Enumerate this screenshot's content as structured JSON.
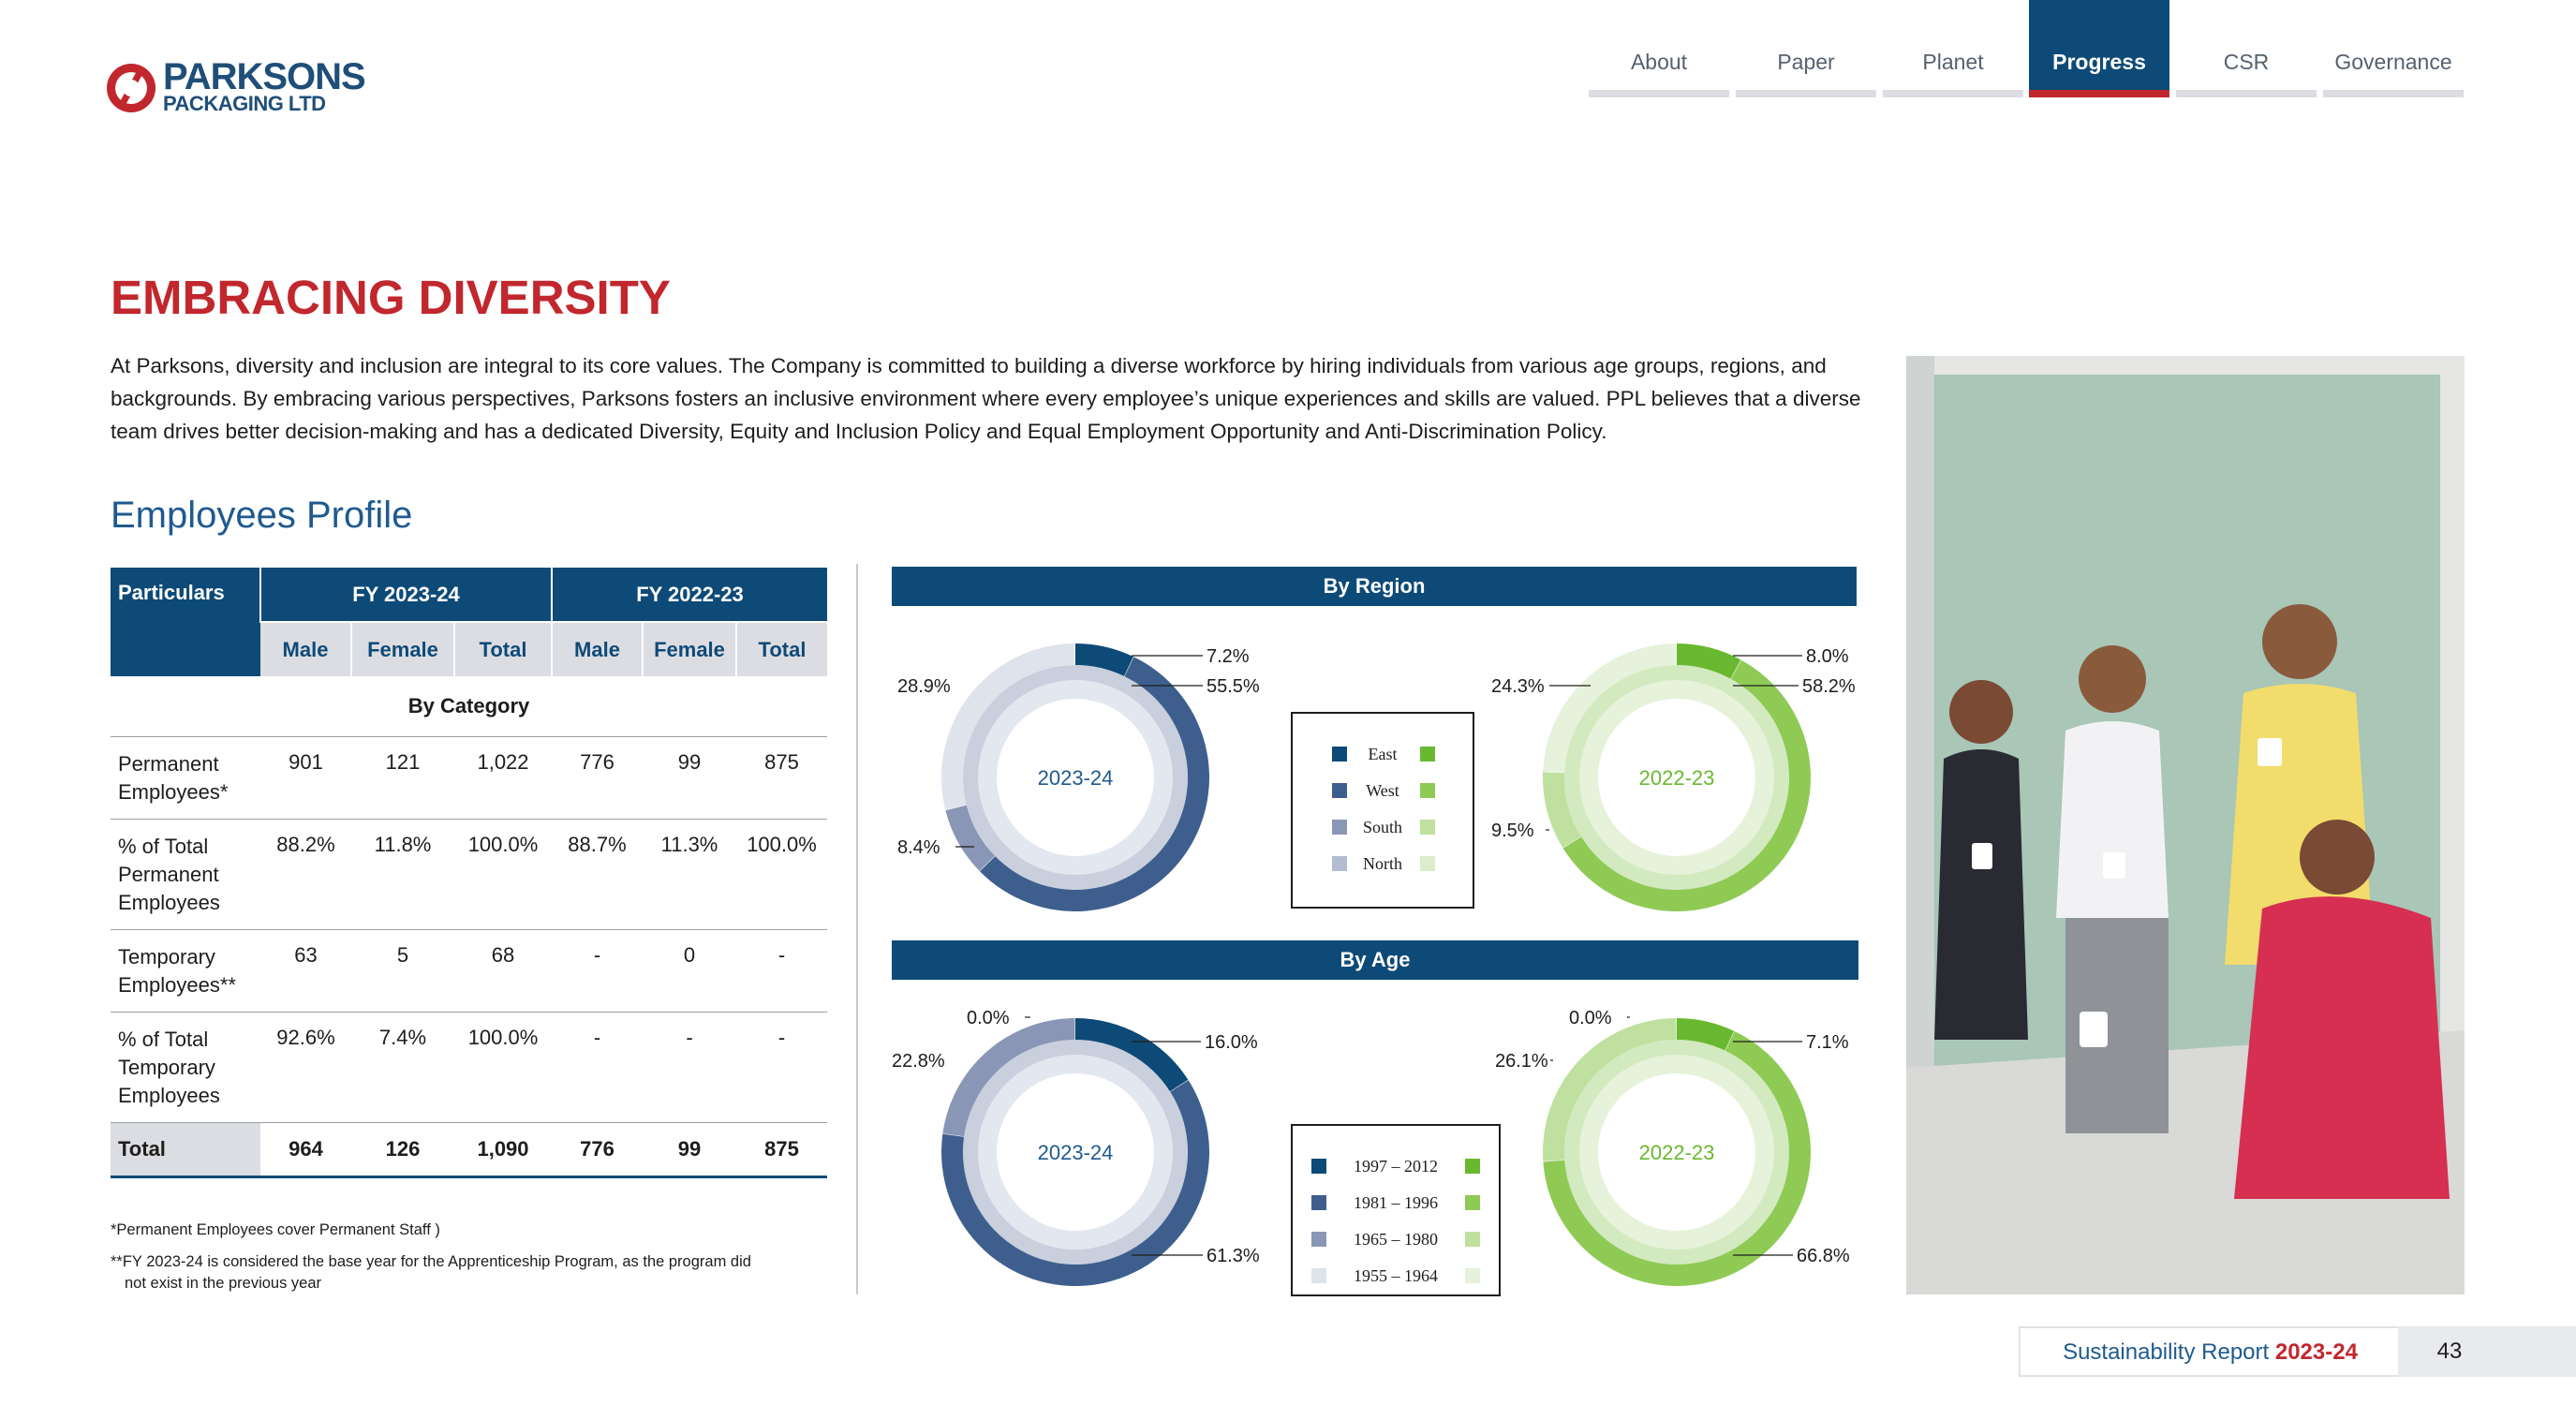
{
  "brand": {
    "line1": "PARKSONS",
    "line2": "PACKAGING LTD"
  },
  "nav": [
    {
      "label": "About",
      "active": false
    },
    {
      "label": "Paper",
      "active": false
    },
    {
      "label": "Planet",
      "active": false
    },
    {
      "label": "Progress",
      "active": true
    },
    {
      "label": "CSR",
      "active": false
    },
    {
      "label": "Governance",
      "active": false
    }
  ],
  "title": "EMBRACING DIVERSITY",
  "intro": "At Parksons, diversity and inclusion are integral to its core values. The Company is committed to building a diverse workforce by hiring individuals from various age groups, regions, and backgrounds. By embracing various perspectives, Parksons fosters an inclusive environment where every employee’s unique experiences and skills are valued. PPL believes that a diverse team drives better decision-making and has a dedicated Diversity, Equity and Inclusion Policy and Equal Employment Opportunity and Anti-Discrimination Policy.",
  "section_title": "Employees Profile",
  "table": {
    "particulars": "Particulars",
    "fy1": "FY 2023-24",
    "fy2": "FY 2022-23",
    "subheads": [
      "Male",
      "Female",
      "Total",
      "Male",
      "Female",
      "Total"
    ],
    "category": "By Category",
    "rows": [
      {
        "label": "Permanent Employees*",
        "values": [
          "901",
          "121",
          "1,022",
          "776",
          "99",
          "875"
        ]
      },
      {
        "label": "% of Total Permanent Employees",
        "values": [
          "88.2%",
          "11.8%",
          "100.0%",
          "88.7%",
          "11.3%",
          "100.0%"
        ]
      },
      {
        "label": "Temporary Employees**",
        "values": [
          "63",
          "5",
          "68",
          "-",
          "0",
          "-"
        ]
      },
      {
        "label": "% of Total Temporary Employees",
        "values": [
          "92.6%",
          "7.4%",
          "100.0%",
          "-",
          "-",
          "-"
        ]
      }
    ],
    "total": {
      "label": "Total",
      "values": [
        "964",
        "126",
        "1,090",
        "776",
        "99",
        "875"
      ]
    }
  },
  "footnotes": {
    "f1": "*Permanent Employees cover Permanent Staff )",
    "f2a": "**FY 2023-24 is considered the base year for the Apprenticeship Program, as the program did",
    "f2b": "not exist in the previous year"
  },
  "colors": {
    "blue": [
      "#0e4a77",
      "#3e5f8e",
      "#8996b5",
      "#dfe3ec"
    ],
    "green": [
      "#6ab82f",
      "#8fca55",
      "#bfe09e",
      "#e6f2dc"
    ],
    "accent_red": "#c1272d",
    "nav_blue": "#0e4a77"
  },
  "chart_data": [
    {
      "type": "pie",
      "title": "By Region",
      "center_label": "2023-24",
      "categories": [
        "East",
        "West",
        "South",
        "North"
      ],
      "values": [
        7.2,
        55.5,
        8.4,
        28.9
      ],
      "labels": [
        "7.2%",
        "55.5%",
        "8.4%",
        "28.9%"
      ]
    },
    {
      "type": "pie",
      "title": "By Region",
      "center_label": "2022-23",
      "categories": [
        "East",
        "West",
        "South",
        "North"
      ],
      "values": [
        8.0,
        58.2,
        9.5,
        24.3
      ],
      "labels": [
        "8.0%",
        "58.2%",
        "9.5%",
        "24.3%"
      ]
    },
    {
      "type": "pie",
      "title": "By Age",
      "center_label": "2023-24",
      "categories": [
        "1997 – 2012",
        "1981 – 1996",
        "1965 – 1980",
        "1955 – 1964"
      ],
      "values": [
        16.0,
        61.3,
        22.8,
        0.0
      ],
      "labels": [
        "16.0%",
        "61.3%",
        "22.8%",
        "0.0%"
      ]
    },
    {
      "type": "pie",
      "title": "By Age",
      "center_label": "2022-23",
      "categories": [
        "1997 – 2012",
        "1981 – 1996",
        "1965 – 1980",
        "1955 – 1964"
      ],
      "values": [
        7.1,
        66.8,
        26.1,
        0.0
      ],
      "labels": [
        "7.1%",
        "66.8%",
        "26.1%",
        "0.0%"
      ]
    }
  ],
  "chart_headers": {
    "region": "By Region",
    "age": "By Age"
  },
  "legends": {
    "region": [
      "East",
      "West",
      "South",
      "North"
    ],
    "age": [
      "1997 – 2012",
      "1981 – 1996",
      "1965 – 1980",
      "1955 – 1964"
    ]
  },
  "footer": {
    "report": "Sustainability Report",
    "year": "2023-24",
    "page": "43"
  }
}
